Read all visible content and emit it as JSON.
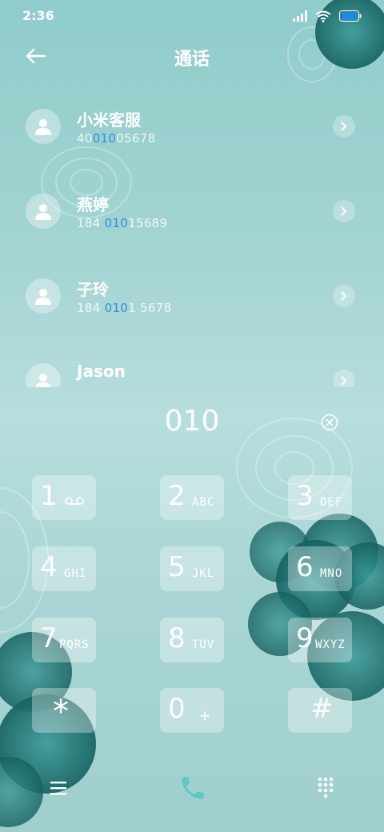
{
  "status": {
    "time": "2:36"
  },
  "header": {
    "title": "通话"
  },
  "contacts": [
    {
      "name": "小米客服",
      "num_pre": "40",
      "num_hl": "010",
      "num_post": "05678"
    },
    {
      "name": "燕婷",
      "num_pre": "184 ",
      "num_hl": "010",
      "num_post": "15689"
    },
    {
      "name": "子玲",
      "num_pre": "184 ",
      "num_hl": "010",
      "num_post": "1 5678"
    },
    {
      "name": "Jason",
      "num_pre": "",
      "num_hl": "",
      "num_post": ""
    }
  ],
  "dialer": {
    "entered": "010"
  },
  "keys": [
    {
      "digit": "1",
      "letters": ""
    },
    {
      "digit": "2",
      "letters": "ABC"
    },
    {
      "digit": "3",
      "letters": "DEF"
    },
    {
      "digit": "4",
      "letters": "GHI"
    },
    {
      "digit": "5",
      "letters": "JKL"
    },
    {
      "digit": "6",
      "letters": "MNO"
    },
    {
      "digit": "7",
      "letters": "PQRS"
    },
    {
      "digit": "8",
      "letters": "TUV"
    },
    {
      "digit": "9",
      "letters": "WXYZ"
    },
    {
      "digit": "*",
      "letters": ""
    },
    {
      "digit": "0",
      "letters": "+"
    },
    {
      "digit": "#",
      "letters": ""
    }
  ],
  "icons": {
    "signal": "signal-icon",
    "wifi": "wifi-icon",
    "battery": "battery-icon",
    "back": "back-arrow-icon",
    "avatar": "person-icon",
    "chevron": "chevron-right-icon",
    "clear": "clear-icon",
    "voicemail": "voicemail-icon",
    "menu": "menu-icon",
    "call": "phone-icon",
    "keypad": "dialpad-icon"
  },
  "colors": {
    "highlight": "#2e8be6",
    "battery": "#1e88e5",
    "call_icon": "#5ec7c8"
  }
}
